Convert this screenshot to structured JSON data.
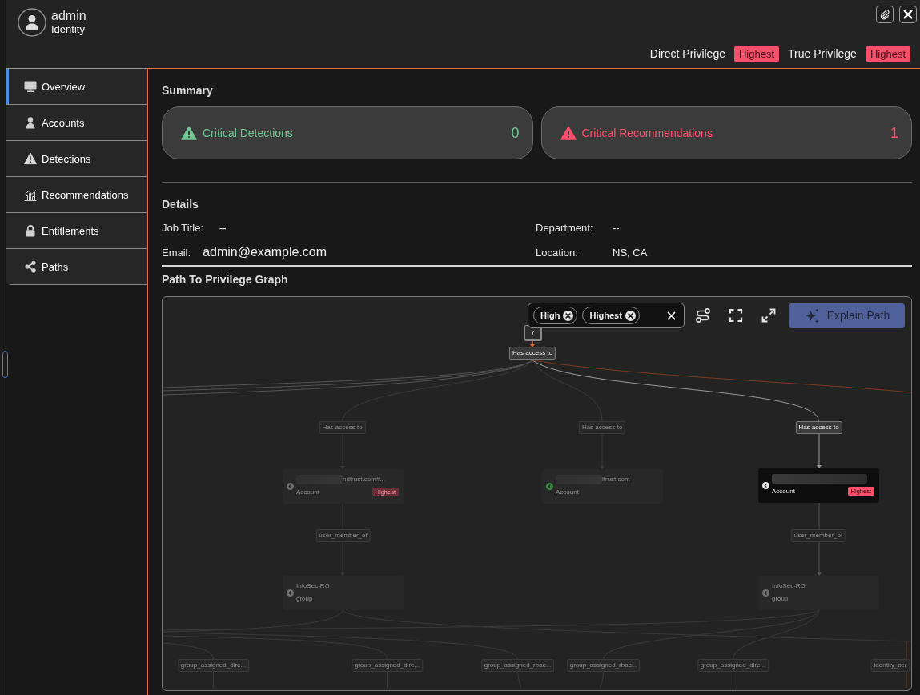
{
  "header": {
    "name": "admin",
    "subtitle": "Identity",
    "privileges": [
      {
        "label": "Direct Privilege",
        "value": "Highest"
      },
      {
        "label": "True Privilege",
        "value": "Highest"
      }
    ]
  },
  "sidebar": {
    "items": [
      {
        "label": "Overview",
        "selected": true
      },
      {
        "label": "Accounts",
        "selected": false
      },
      {
        "label": "Detections",
        "selected": false
      },
      {
        "label": "Recommendations",
        "selected": false
      },
      {
        "label": "Entitlements",
        "selected": false
      },
      {
        "label": "Paths",
        "selected": false
      }
    ]
  },
  "summary": {
    "title": "Summary",
    "cards": [
      {
        "label": "Critical Detections",
        "count": "0",
        "color": "#74c795"
      },
      {
        "label": "Critical Recommendations",
        "count": "1",
        "color": "#ff4f6b"
      }
    ]
  },
  "details": {
    "title": "Details",
    "fields": [
      {
        "kind": "text",
        "label": "Job Title:",
        "value": "--"
      },
      {
        "kind": "text",
        "label": "Department:",
        "value": "--"
      },
      {
        "kind": "email",
        "label": "Email:",
        "value": "admin@example.com"
      },
      {
        "kind": "text",
        "label": "Location:",
        "value": "NS, CA"
      }
    ]
  },
  "graph": {
    "title": "Path To Privilege Graph",
    "filters": [
      {
        "label": "High"
      },
      {
        "label": "Highest"
      }
    ],
    "explain_button": "Explain Path",
    "nodes": [
      {
        "kind": "count",
        "label": "7",
        "highlighted": true
      },
      {
        "kind": "edge",
        "label": "Has access to",
        "highlighted": true
      },
      {
        "kind": "edge",
        "label": "Has access to",
        "highlighted": false
      },
      {
        "kind": "edge",
        "label": "Has access to",
        "highlighted": false
      },
      {
        "kind": "edge",
        "label": "Has access to",
        "highlighted": true
      },
      {
        "kind": "entity",
        "title": "ndtrust.com#...",
        "redacted": true,
        "subtitle": "Account",
        "badge": "Highest",
        "highlighted": false,
        "color": "#707070"
      },
      {
        "kind": "entity",
        "title": "ltrust.com",
        "redacted": true,
        "subtitle": "Account",
        "highlighted": false,
        "color": "#3f8a47"
      },
      {
        "kind": "entity",
        "redacted": true,
        "subtitle": "Account",
        "badge": "Highest",
        "highlighted": true,
        "color": "#e6e6e6"
      },
      {
        "kind": "edge",
        "label": "user_member_of",
        "highlighted": false
      },
      {
        "kind": "edge",
        "label": "user_member_of",
        "highlighted": false
      },
      {
        "kind": "entity",
        "title": "InfoSec-RO",
        "redacted": false,
        "subtitle": "group",
        "highlighted": false,
        "color": "#707070"
      },
      {
        "kind": "entity",
        "title": "InfoSec-RO",
        "redacted": false,
        "subtitle": "group",
        "highlighted": false,
        "color": "#707070"
      },
      {
        "kind": "edge",
        "label": "group_assigned_dire...",
        "highlighted": false
      },
      {
        "kind": "edge",
        "label": "group_assigned_dire...",
        "highlighted": false
      },
      {
        "kind": "edge",
        "label": "group_assigned_rbac...",
        "highlighted": false
      },
      {
        "kind": "edge",
        "label": "group_assigned_rbac...",
        "highlighted": false
      },
      {
        "kind": "edge",
        "label": "group_assigned_dire...",
        "highlighted": false
      },
      {
        "kind": "edge",
        "label": "identity_cer",
        "highlighted": false
      }
    ]
  }
}
